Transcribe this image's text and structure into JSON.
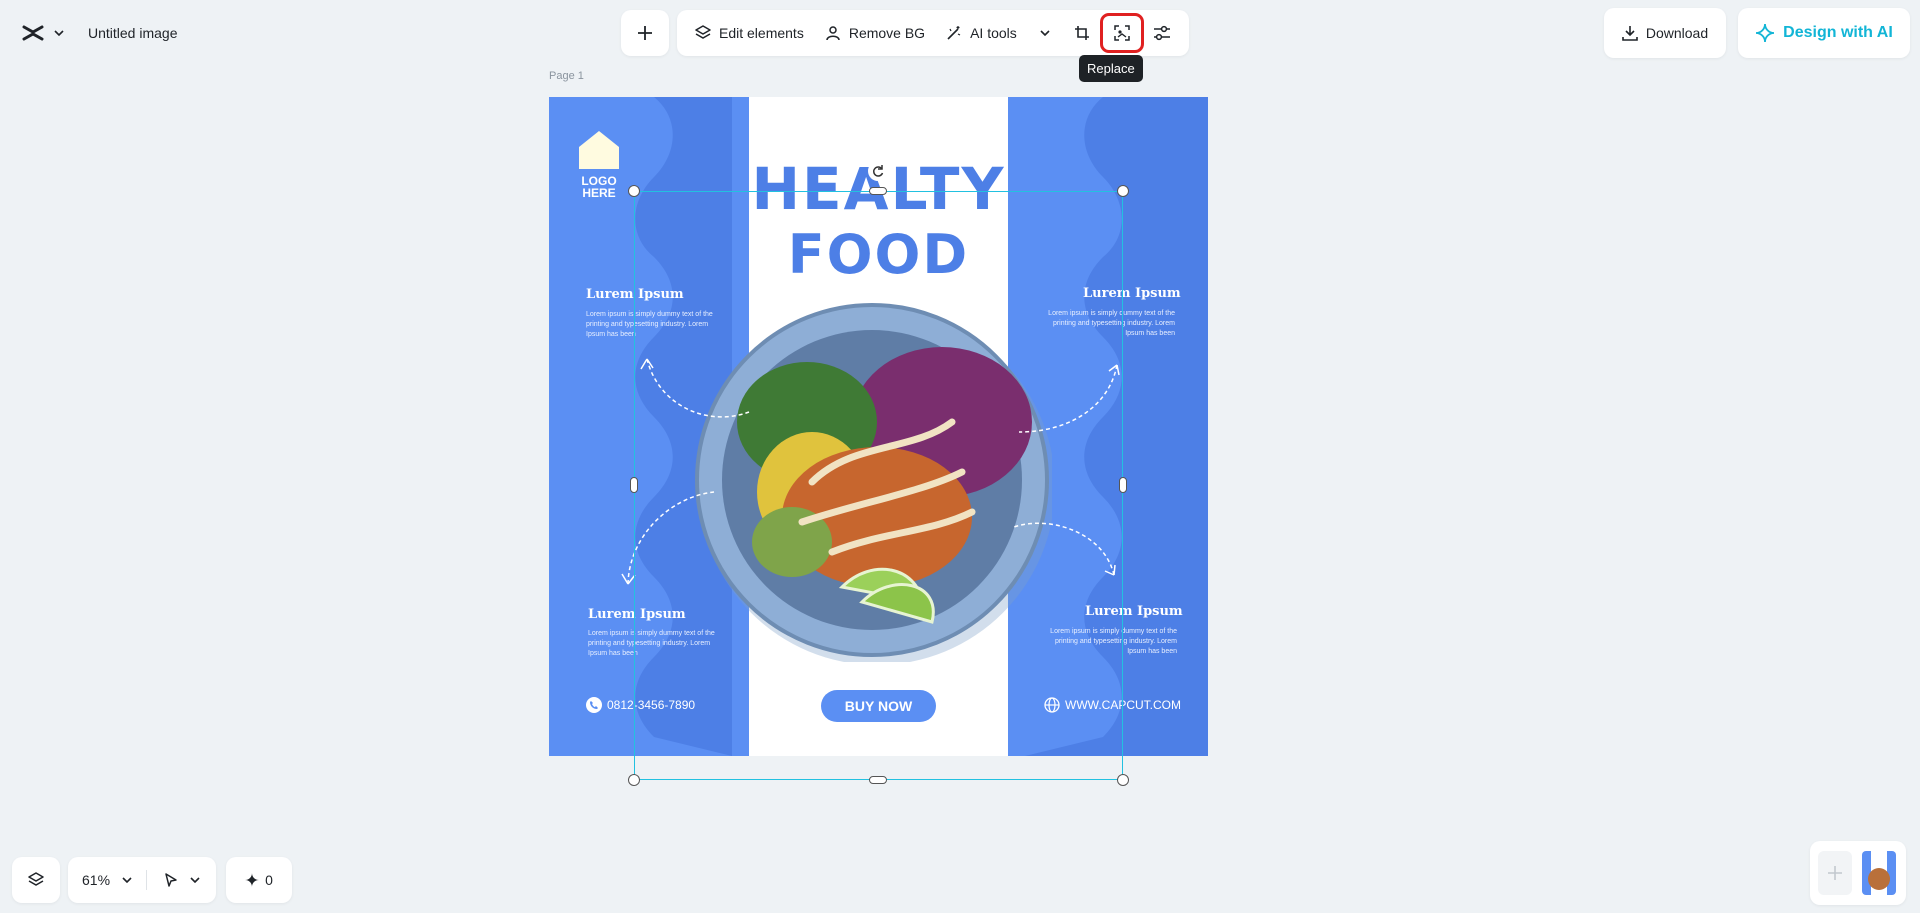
{
  "header": {
    "document_title": "Untitled image",
    "toolbar": {
      "edit_elements": "Edit elements",
      "remove_bg": "Remove BG",
      "ai_tools": "AI tools"
    },
    "tooltip": "Replace",
    "download_label": "Download",
    "design_ai_label": "Design with AI"
  },
  "canvas": {
    "page_label": "Page 1",
    "design": {
      "logo_text": "LOGO HERE",
      "title_line1": "HEALTY",
      "title_line2": "FOOD",
      "side_title": "Lurem Ipsum",
      "side_text": "Lorem ipsum is simply dummy text of the printing and typesetting industry. Lorem Ipsum has been",
      "phone": "0812-3456-7890",
      "website": "WWW.CAPCUT.COM",
      "button_label": "BUY NOW"
    }
  },
  "footer": {
    "zoom": "61%",
    "ai_credits": "0"
  },
  "colors": {
    "accent_cyan": "#12b5d6",
    "design_blue": "#5b8ff3",
    "highlight_red": "#e02020"
  }
}
